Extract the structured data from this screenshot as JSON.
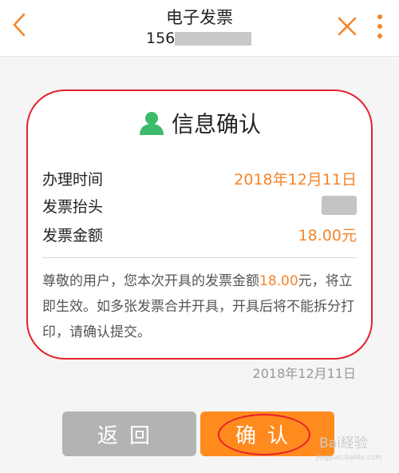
{
  "header": {
    "title": "电子发票",
    "phone_prefix": "156",
    "icons": [
      "back-arrow-icon",
      "close-icon",
      "more-vertical-icon"
    ]
  },
  "card": {
    "heading": "信息确认",
    "heading_icon": "user-icon",
    "rows": [
      {
        "label": "办理时间",
        "value": "2018年12月11日"
      },
      {
        "label": "发票抬头",
        "value": ""
      },
      {
        "label": "发票金额",
        "value": "18.00元"
      }
    ],
    "notice_before": "尊敬的用户，您本次开具的发票金额",
    "notice_amount": "18.00",
    "notice_after": "元，将立即生效。如多张发票合并开具，开具后将不能拆分打印，请确认提交。"
  },
  "footer_date": "2018年12月11日",
  "buttons": {
    "back": "返回",
    "confirm": "确认"
  },
  "watermark": {
    "text": "Bai経验",
    "sub": "jingyan.baidu.com"
  },
  "colors": {
    "accent": "#ff8a1e",
    "value_text": "#f5852a",
    "annotation": "#e5212d",
    "back_button": "#b3b3b3",
    "user_icon": "#3cbc6b"
  }
}
